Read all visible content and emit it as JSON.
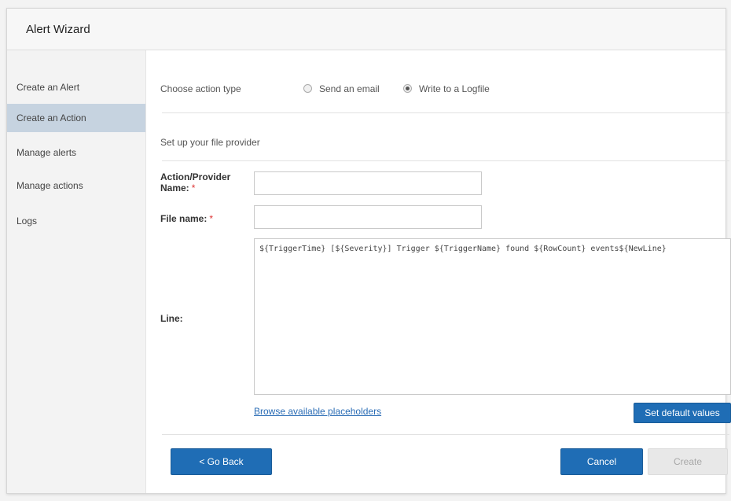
{
  "dialog": {
    "title": "Alert Wizard"
  },
  "sidebar": {
    "items": [
      {
        "label": "Create an Alert"
      },
      {
        "label": "Create an Action"
      },
      {
        "label": "Manage alerts"
      },
      {
        "label": "Manage actions"
      },
      {
        "label": "Logs"
      }
    ]
  },
  "action_type": {
    "label": "Choose action type",
    "options": [
      {
        "label": "Send an email",
        "selected": false
      },
      {
        "label": "Write to a Logfile",
        "selected": true
      }
    ]
  },
  "section": {
    "heading": "Set up your file provider"
  },
  "form": {
    "provider_name": {
      "label_line1": "Action/Provider",
      "label_line2": "Name:",
      "value": ""
    },
    "file_name": {
      "label": "File name:",
      "value": ""
    },
    "line": {
      "label": "Line:",
      "value": "${TriggerTime} [${Severity}] Trigger ${TriggerName} found ${RowCount} events${NewLine}"
    },
    "required_mark": "*"
  },
  "links": {
    "browse_placeholders": "Browse available placeholders"
  },
  "buttons": {
    "set_default": "Set default values",
    "go_back": "< Go Back",
    "cancel": "Cancel",
    "create": "Create"
  },
  "colors": {
    "primary": "#1f6db5",
    "sidebar_active": "#c6d3e0",
    "required": "#dd3333",
    "link": "#2a6cb5"
  }
}
